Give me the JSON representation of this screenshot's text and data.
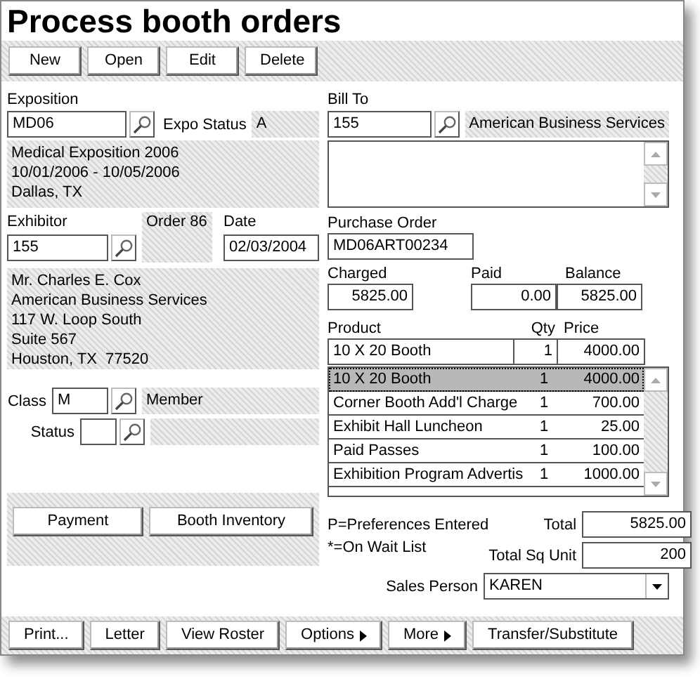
{
  "title": "Process booth orders",
  "toolbar": [
    "New",
    "Open",
    "Edit",
    "Delete"
  ],
  "exposition": {
    "label": "Exposition",
    "value": "MD06",
    "status_label": "Expo Status",
    "status": "A",
    "info": [
      "Medical Exposition 2006",
      "10/01/2006 - 10/05/2006",
      "Dallas, TX"
    ]
  },
  "exhibitor": {
    "label": "Exhibitor",
    "value": "155",
    "order": "Order 86",
    "date_label": "Date",
    "date": "02/03/2004",
    "address": [
      "Mr. Charles E. Cox",
      "American Business Services",
      "117 W. Loop South",
      "Suite 567",
      "Houston, TX  77520"
    ]
  },
  "class": {
    "label": "Class",
    "value": "M",
    "description": "Member"
  },
  "status": {
    "label": "Status"
  },
  "actions": [
    "Payment",
    "Booth Inventory"
  ],
  "bill_to": {
    "label": "Bill To",
    "value": "155",
    "name": "American Business Services"
  },
  "purchase_order": {
    "label": "Purchase Order",
    "value": "MD06ART00234"
  },
  "amounts": [
    {
      "label": "Charged",
      "value": "5825.00"
    },
    {
      "label": "Paid",
      "value": "0.00"
    },
    {
      "label": "Balance",
      "value": "5825.00"
    }
  ],
  "products": {
    "columns": [
      "Product",
      "Qty",
      "Price"
    ],
    "edit_row": {
      "product": "10 X 20 Booth",
      "qty": "1",
      "price": "4000.00"
    },
    "rows": [
      {
        "product": "10 X 20 Booth",
        "qty": "1",
        "price": "4000.00",
        "selected": true
      },
      {
        "product": "Corner Booth Add'l Charge",
        "qty": "1",
        "price": "700.00",
        "selected": false
      },
      {
        "product": "Exhibit Hall Luncheon",
        "qty": "1",
        "price": "25.00",
        "selected": false
      },
      {
        "product": "Paid Passes",
        "qty": "1",
        "price": "100.00",
        "selected": false
      },
      {
        "product": "Exhibition Program Advertis",
        "qty": "1",
        "price": "1000.00",
        "selected": false
      }
    ]
  },
  "legend": [
    "P=Preferences Entered",
    "*=On Wait List"
  ],
  "totals": [
    {
      "label": "Total",
      "value": "5825.00"
    },
    {
      "label": "Total Sq Unit",
      "value": "200"
    }
  ],
  "sales_person": {
    "label": "Sales Person",
    "value": "KAREN"
  },
  "bottom_buttons": [
    {
      "label": "Print...",
      "submenu": false
    },
    {
      "label": "Letter",
      "submenu": false
    },
    {
      "label": "View Roster",
      "submenu": false
    },
    {
      "label": "Options",
      "submenu": true
    },
    {
      "label": "More",
      "submenu": true
    },
    {
      "label": "Transfer/Substitute",
      "submenu": false
    }
  ]
}
